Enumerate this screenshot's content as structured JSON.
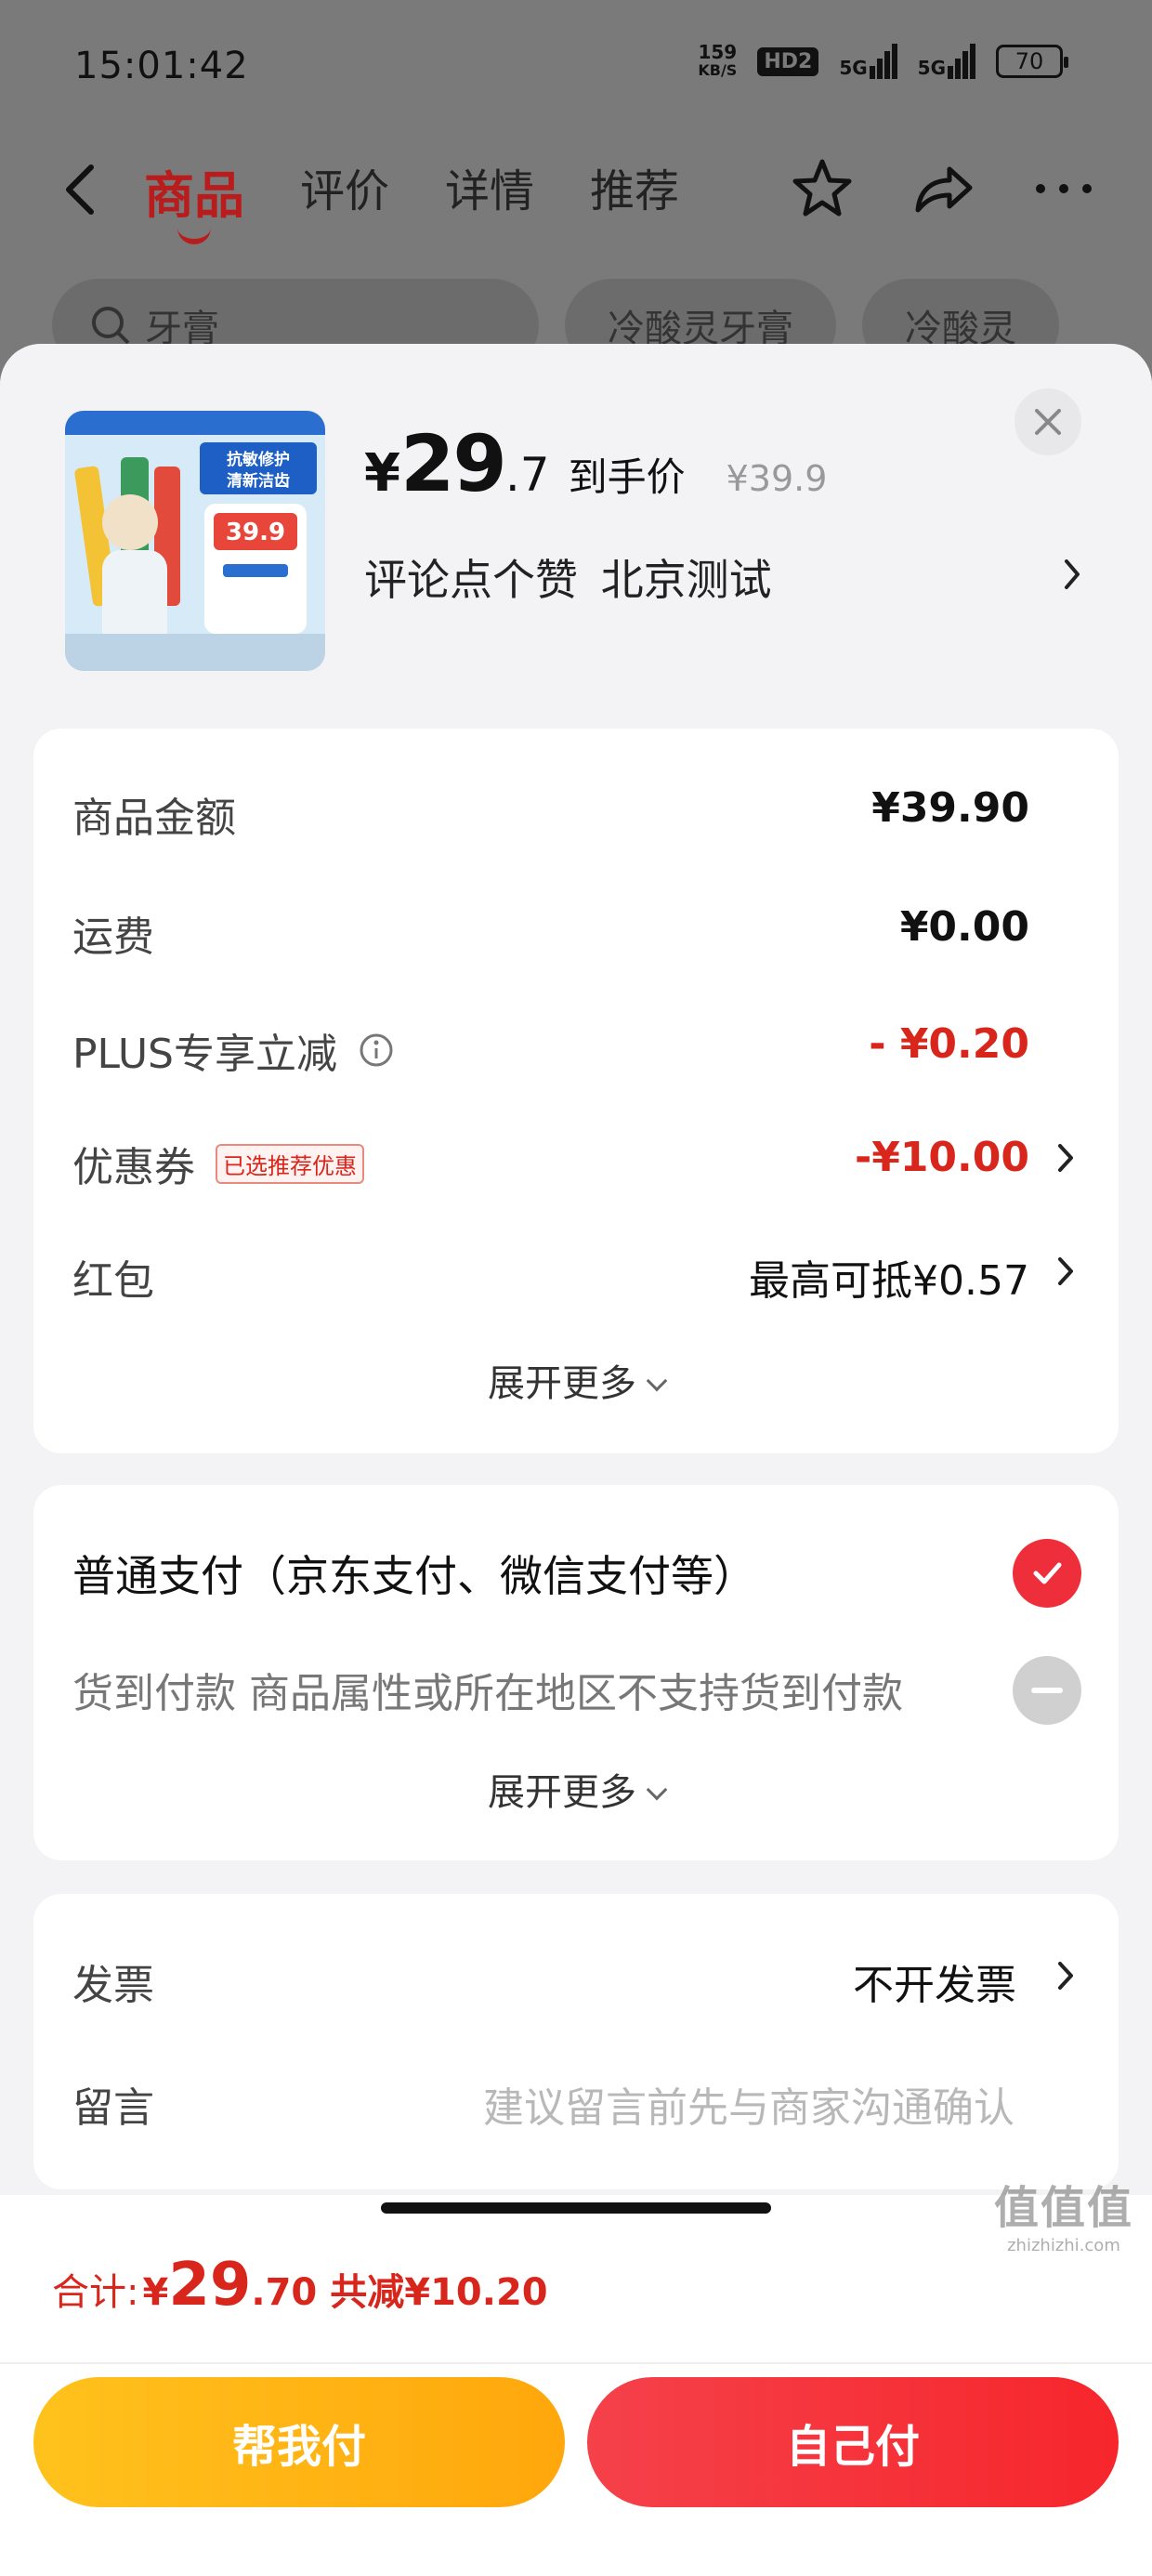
{
  "status_bar": {
    "time": "15:01:42",
    "speed_top": "159",
    "speed_unit": "KB/S",
    "hd": "HD2",
    "signal1": "5G",
    "signal2": "5G",
    "battery": "70"
  },
  "nav": {
    "tabs": [
      "商品",
      "评价",
      "详情",
      "推荐"
    ]
  },
  "background_search": {
    "search_text": "牙膏",
    "chip1": "冷酸灵牙膏",
    "chip2": "冷酸灵"
  },
  "product": {
    "price_symbol": "¥",
    "price_int": "29",
    "price_dec": ".7",
    "price_tag": "到手价",
    "original_price": "¥39.9",
    "spec": "评论点个赞  北京测试",
    "thumb_banner_1": "抗敏修护",
    "thumb_banner_2": "清新洁齿",
    "thumb_price": "39.9"
  },
  "fees": {
    "rows": [
      {
        "label": "商品金额",
        "value": "¥39.90"
      },
      {
        "label": "运费",
        "value": "¥0.00"
      },
      {
        "label": "PLUS专享立减",
        "value": "- ¥0.20"
      },
      {
        "label": "优惠券",
        "badge": "已选推荐优惠",
        "value": "-¥10.00"
      },
      {
        "label": "红包",
        "value": "最高可抵¥0.57"
      }
    ],
    "expand_label": "展开更多"
  },
  "payment": {
    "options": [
      {
        "label": "普通支付（京东支付、微信支付等）",
        "selected": true
      },
      {
        "label": "货到付款 商品属性或所在地区不支持货到付款",
        "selected": false
      }
    ],
    "expand_label": "展开更多"
  },
  "misc": {
    "invoice_label": "发票",
    "invoice_value": "不开发票",
    "message_label": "留言",
    "message_placeholder": "建议留言前先与商家沟通确认"
  },
  "footer": {
    "total_label": "合计:",
    "total_symbol": "¥",
    "total_int": "29",
    "total_dec": ".70",
    "total_saved": "共减¥10.20",
    "help_pay": "帮我付",
    "self_pay": "自己付"
  },
  "watermark": {
    "main": "值值值",
    "sub": "zhizhizhi.com"
  },
  "colors": {
    "accent_red": "#d8261c",
    "pay_red": "#f6262c",
    "help_yellow": "#ffb312"
  }
}
